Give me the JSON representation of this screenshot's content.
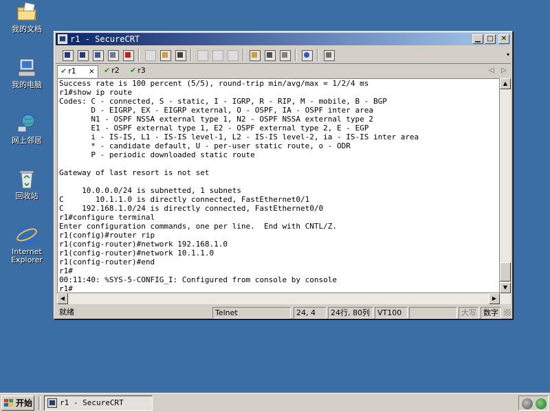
{
  "desktop": {
    "icons": [
      {
        "name": "my-documents",
        "label": "我的文档"
      },
      {
        "name": "my-computer",
        "label": "我的电脑"
      },
      {
        "name": "network-places",
        "label": "网上邻居"
      },
      {
        "name": "recycle-bin",
        "label": "回收站"
      },
      {
        "name": "internet-explorer",
        "label_line1": "Internet",
        "label_line2": "Explorer"
      }
    ]
  },
  "window": {
    "title": "r1 - SecureCRT",
    "tabs": [
      {
        "label": "r1",
        "active": true,
        "close": "×"
      },
      {
        "label": "r2",
        "active": false
      },
      {
        "label": "r3",
        "active": false
      }
    ],
    "tab_nav": {
      "prev": "◁",
      "next": "▷"
    },
    "terminal_lines": [
      "Success rate is 100 percent (5/5), round-trip min/avg/max = 1/2/4 ms",
      "r1#show ip route",
      "Codes: C - connected, S - static, I - IGRP, R - RIP, M - mobile, B - BGP",
      "       D - EIGRP, EX - EIGRP external, O - OSPF, IA - OSPF inter area",
      "       N1 - OSPF NSSA external type 1, N2 - OSPF NSSA external type 2",
      "       E1 - OSPF external type 1, E2 - OSPF external type 2, E - EGP",
      "       i - IS-IS, L1 - IS-IS level-1, L2 - IS-IS level-2, ia - IS-IS inter area",
      "       * - candidate default, U - per-user static route, o - ODR",
      "       P - periodic downloaded static route",
      "",
      "Gateway of last resort is not set",
      "",
      "     10.0.0.0/24 is subnetted, 1 subnets",
      "C       10.1.1.0 is directly connected, FastEthernet0/1",
      "C    192.168.1.0/24 is directly connected, FastEthernet0/0",
      "r1#configure terminal",
      "Enter configuration commands, one per line.  End with CNTL/Z.",
      "r1(config)#router rip",
      "r1(config-router)#network 192.168.1.0",
      "r1(config-router)#network 10.1.1.0",
      "r1(config-router)#end",
      "r1#",
      "00:11:40: %SYS-5-CONFIG_I: Configured from console by console",
      "r1#"
    ],
    "status": {
      "ready": "就绪",
      "protocol": "Telnet",
      "cursor_pos": "24,  4",
      "size": "24行, 80列",
      "emulation": "VT100",
      "caps": "大写",
      "num": "数字"
    }
  },
  "taskbar": {
    "start_label": "开始",
    "task_label": "r1 - SecureCRT"
  },
  "colors": {
    "desktop": "#3a6ea5",
    "title_start": "#0a246a",
    "title_end": "#a6caf0",
    "chrome": "#d4d0c8",
    "tab_check": "#1a9a1a"
  }
}
